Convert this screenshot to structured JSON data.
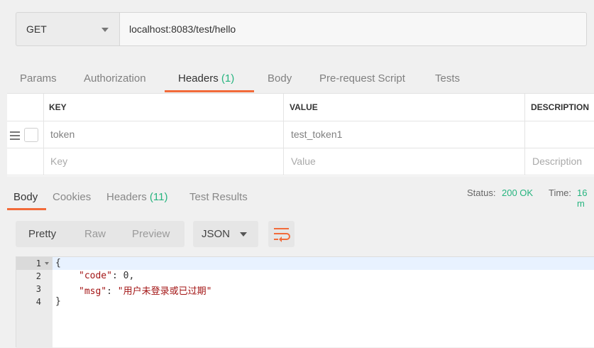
{
  "request": {
    "method": "GET",
    "url": "localhost:8083/test/hello"
  },
  "request_tabs": [
    {
      "label": "Params"
    },
    {
      "label": "Authorization"
    },
    {
      "label": "Headers",
      "count": "(1)"
    },
    {
      "label": "Body"
    },
    {
      "label": "Pre-request Script"
    },
    {
      "label": "Tests"
    }
  ],
  "headers_table": {
    "columns": [
      "KEY",
      "VALUE",
      "DESCRIPTION"
    ],
    "rows": [
      {
        "key": "token",
        "value": "test_token1",
        "description": ""
      }
    ],
    "placeholder": {
      "key": "Key",
      "value": "Value",
      "description": "Description"
    }
  },
  "response_tabs": [
    {
      "label": "Body"
    },
    {
      "label": "Cookies"
    },
    {
      "label": "Headers",
      "count": "(11)"
    },
    {
      "label": "Test Results"
    }
  ],
  "response_meta": {
    "status_label": "Status:",
    "status_value": "200 OK",
    "time_label": "Time:",
    "time_value": "16 m"
  },
  "view_modes": [
    "Pretty",
    "Raw",
    "Preview"
  ],
  "format": "JSON",
  "code": {
    "line_numbers": [
      "1",
      "2",
      "3",
      "4"
    ],
    "open_brace": "{",
    "close_brace": "}",
    "code_key": "\"code\"",
    "code_value": "0,",
    "msg_key": "\"msg\"",
    "msg_value": "\"用户未登录或已过期\""
  },
  "colors": {
    "accent": "#f26b3a",
    "success": "#26b47f"
  }
}
